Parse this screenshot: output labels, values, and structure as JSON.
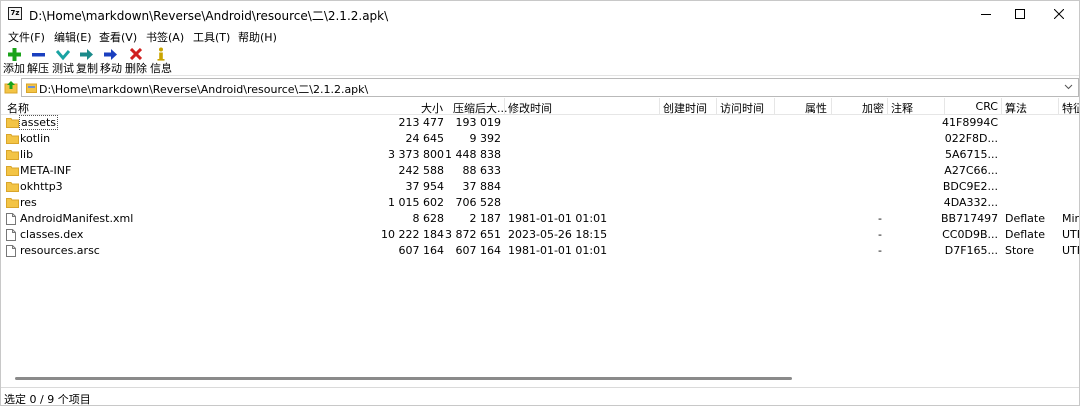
{
  "window": {
    "title": "D:\\Home\\markdown\\Reverse\\Android\\resource\\二\\2.1.2.apk\\",
    "app_icon_text": "7z"
  },
  "menu": [
    "文件(F)",
    "编辑(E)",
    "查看(V)",
    "书签(A)",
    "工具(T)",
    "帮助(H)"
  ],
  "toolbar": {
    "add": {
      "label": "添加",
      "icon": "plus-icon",
      "color": "#1aa31a"
    },
    "extract": {
      "label": "解压",
      "icon": "minus-icon",
      "color": "#1a3fbf"
    },
    "test": {
      "label": "测试",
      "icon": "check-icon",
      "color": "#1aa3a3"
    },
    "copy": {
      "label": "复制",
      "icon": "copy-arrow-icon",
      "color": "#1a8a8a"
    },
    "move": {
      "label": "移动",
      "icon": "move-arrow-icon",
      "color": "#1a3fbf"
    },
    "delete": {
      "label": "删除",
      "icon": "delete-x-icon",
      "color": "#d02020"
    },
    "info": {
      "label": "信息",
      "icon": "info-icon",
      "color": "#c9a400"
    }
  },
  "address": {
    "path": "D:\\Home\\markdown\\Reverse\\Android\\resource\\二\\2.1.2.apk\\"
  },
  "columns": {
    "name": "名称",
    "size": "大小",
    "packed": "压缩后大...",
    "modified": "修改时间",
    "created": "创建时间",
    "accessed": "访问时间",
    "attributes": "属性",
    "encrypted": "加密",
    "comment": "注释",
    "crc": "CRC",
    "method": "算法",
    "characteristics": "特征"
  },
  "files": [
    {
      "name": "assets",
      "type": "folder",
      "size": "213 477",
      "packed": "193 019",
      "modified": "",
      "encrypted": "",
      "crc": "41F8994C",
      "method": "",
      "characteristics": ""
    },
    {
      "name": "kotlin",
      "type": "folder",
      "size": "24 645",
      "packed": "9 392",
      "modified": "",
      "encrypted": "",
      "crc": "022F8D...",
      "method": "",
      "characteristics": ""
    },
    {
      "name": "lib",
      "type": "folder",
      "size": "3 373 800",
      "packed": "1 448 838",
      "modified": "",
      "encrypted": "",
      "crc": "5A6715...",
      "method": "",
      "characteristics": ""
    },
    {
      "name": "META-INF",
      "type": "folder",
      "size": "242 588",
      "packed": "88 633",
      "modified": "",
      "encrypted": "",
      "crc": "A27C66...",
      "method": "",
      "characteristics": ""
    },
    {
      "name": "okhttp3",
      "type": "folder",
      "size": "37 954",
      "packed": "37 884",
      "modified": "",
      "encrypted": "",
      "crc": "BDC9E2...",
      "method": "",
      "characteristics": ""
    },
    {
      "name": "res",
      "type": "folder",
      "size": "1 015 602",
      "packed": "706 528",
      "modified": "",
      "encrypted": "",
      "crc": "4DA332...",
      "method": "",
      "characteristics": ""
    },
    {
      "name": "AndroidManifest.xml",
      "type": "file",
      "size": "8 628",
      "packed": "2 187",
      "modified": "1981-01-01 01:01",
      "encrypted": "-",
      "crc": "BB717497",
      "method": "Deflate",
      "characteristics": "Mir"
    },
    {
      "name": "classes.dex",
      "type": "file",
      "size": "10 222 184",
      "packed": "3 872 651",
      "modified": "2023-05-26 18:15",
      "encrypted": "-",
      "crc": "CC0D9B...",
      "method": "Deflate",
      "characteristics": "UTF"
    },
    {
      "name": "resources.arsc",
      "type": "file",
      "size": "607 164",
      "packed": "607 164",
      "modified": "1981-01-01 01:01",
      "encrypted": "-",
      "crc": "D7F165...",
      "method": "Store",
      "characteristics": "UTF"
    }
  ],
  "status": {
    "text": "选定 0 / 9 个项目"
  },
  "colors": {
    "folder": "#f3c445",
    "folder_dark": "#d9a52a",
    "scroll_thumb": "#8a8a8a"
  }
}
